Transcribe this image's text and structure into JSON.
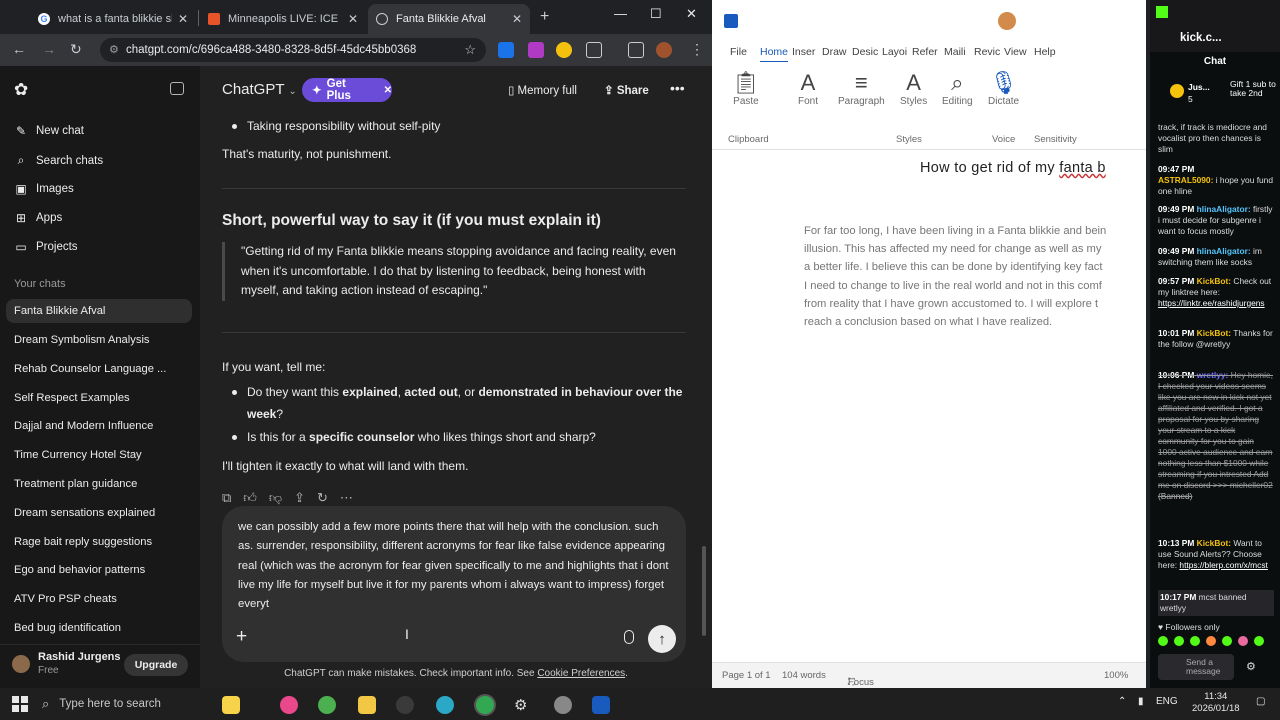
{
  "browser": {
    "tabs": [
      {
        "title": "what is a fanta blikkie slang",
        "active": false
      },
      {
        "title": "Minneapolis LIVE: ICE",
        "active": false
      },
      {
        "title": "Fanta Blikkie Afval",
        "active": true
      }
    ],
    "url": "chatgpt.com/c/696ca488-3480-8328-8d5f-45dc45bb0368"
  },
  "sidebar": {
    "new_chat": "New chat",
    "search_chats": "Search chats",
    "images": "Images",
    "apps": "Apps",
    "projects": "Projects",
    "your_chats": "Your chats",
    "chats": [
      "Fanta Blikkie Afval",
      "Dream Symbolism Analysis",
      "Rehab Counselor Language ...",
      "Self Respect Examples",
      "Dajjal and Modern Influence",
      "Time Currency Hotel Stay",
      "Treatment plan guidance",
      "Dream sensations explained",
      "Rage bait reply suggestions",
      "Ego and behavior patterns",
      "ATV Pro PSP cheats",
      "Bed bug identification"
    ],
    "user_name": "Rashid Jurgens",
    "user_plan": "Free",
    "upgrade": "Upgrade"
  },
  "header": {
    "model": "ChatGPT",
    "get_plus": "Get Plus",
    "memory": "Memory full",
    "share": "Share"
  },
  "conversation": {
    "bullet_top": "Taking responsibility without self-pity",
    "maturity": "That's maturity, not punishment.",
    "heading": "Short, powerful way to say it (if you must explain it)",
    "quote": "\"Getting rid of my Fanta blikkie means stopping avoidance and facing reality, even when it's uncomfortable. I do that by listening to feedback, being honest with myself, and taking action instead of escaping.\"",
    "if_you_want": "If you want, tell me:",
    "q1_pre": "Do they want this ",
    "q1_b1": "explained",
    "q1_m1": ", ",
    "q1_b2": "acted out",
    "q1_m2": ", or ",
    "q1_b3": "demonstrated in behaviour over the week",
    "q1_end": "?",
    "q2_pre": "Is this for a ",
    "q2_b": "specific counselor",
    "q2_end": " who likes things short and sharp?",
    "closing": "I'll tighten it exactly to what will land with them."
  },
  "composer": {
    "text": "we can possibly add a few more points there that will help with the conclusion. such as. surrender, responsibility, different acronyms for fear like false evidence appearing real (which was the acronym for fear given specifically to me and highlights that i dont live my life for myself but live it for my parents whom i always want to impress) forget everyt"
  },
  "footer": {
    "text": "ChatGPT can make mistakes. Check important info. See ",
    "link": "Cookie Preferences",
    "end": "."
  },
  "word": {
    "tabs": [
      "File",
      "Home",
      "Inser",
      "Draw",
      "Desic",
      "Layoi",
      "Refer",
      "Maili",
      "Revic",
      "View",
      "Help"
    ],
    "ribbon": {
      "paste": "Paste",
      "font": "Font",
      "paragraph": "Paragraph",
      "styles": "Styles",
      "editing": "Editing",
      "dictate": "Dictate",
      "clipboard": "Clipboard",
      "styles_group": "Styles",
      "voice": "Voice",
      "sensitivity": "Sensitivity"
    },
    "doc_title_pre": "How to get rid of my ",
    "doc_title_sq": "fanta b",
    "body_lines": [
      "For far too long, I have been living in a Fanta blikkie and bein",
      "illusion. This has affected my need for change as well as my",
      "a better life. I believe this can be done by identifying key fact",
      "I need to change to live in the real world and not in this comf",
      "from reality that I have grown accustomed to. I will explore t",
      "reach a conclusion based on what I have realized."
    ],
    "status": {
      "page": "Page 1 of 1",
      "words": "104 words",
      "focus": "Focus",
      "zoom": "100%"
    }
  },
  "kick": {
    "channel": "kick.c...",
    "chat_label": "Chat",
    "gift_user": "Jus...",
    "gift_count": "5",
    "gift_text": "Gift 1 sub to take 2nd",
    "messages": [
      {
        "time": "",
        "user": "",
        "text": "track, if track is mediocre and vocalist pro then chances is slim"
      },
      {
        "time": "09:47 PM",
        "user": "ASTRAL5090:",
        "text": "i hope you fund one hline"
      },
      {
        "time": "09:49 PM",
        "user": "hlinaAligator:",
        "text": "firstly i must decide for subgenre i want to focus mostly"
      },
      {
        "time": "09:49 PM",
        "user": "hlinaAligator:",
        "text": "im switching them like socks"
      },
      {
        "time": "09:57 PM",
        "user": "KickBot:",
        "text": "Check out my linktree here:",
        "link": "https://linktr.ee/rashidjurgens"
      },
      {
        "time": "10:01 PM",
        "user": "KickBot:",
        "text": "Thanks for the follow @wretlyy"
      },
      {
        "time": "10:06 PM",
        "user": "wretlyy:",
        "text": "Hey homie, I checked your videos seems like you are new in kick not yet affiliated and verified. I got a proposal for you by sharing your stream to a kick community for you to gain 1000 active audience and earn nothing less than $1000 while streaming if you intrested Add me on discord >>> micheller02",
        "deleted": true,
        "tag": "(Banned)"
      },
      {
        "time": "10:13 PM",
        "user": "KickBot:",
        "text": "Want to use Sound Alerts?? Choose here:",
        "link": "https://blerp.com/x/mcst"
      },
      {
        "time": "10:17 PM",
        "user": "",
        "text": "mcst banned wretlyy"
      }
    ],
    "followers_only": "Followers only",
    "send_placeholder": "Send a message"
  },
  "taskbar": {
    "search": "Type here to search",
    "lang": "ENG",
    "time": "11:34",
    "date": "2026/01/18"
  }
}
